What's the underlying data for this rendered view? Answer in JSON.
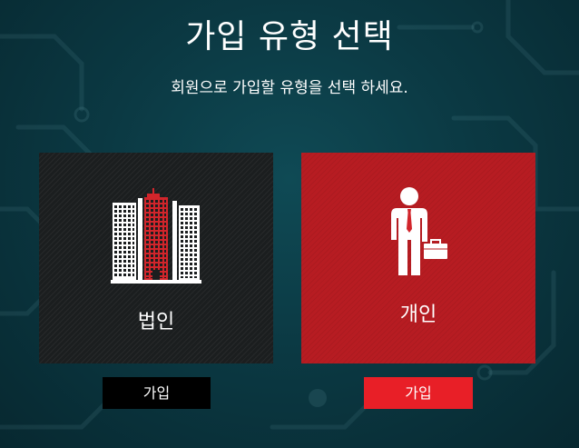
{
  "header": {
    "title": "가입 유형 선택",
    "subtitle": "회원으로 가입할 유형을 선택 하세요."
  },
  "cards": {
    "corporate": {
      "label": "법인",
      "icon": "buildings-icon",
      "join_label": "가입"
    },
    "personal": {
      "label": "개인",
      "icon": "businessman-icon",
      "join_label": "가입"
    }
  },
  "colors": {
    "background": "#0b3943",
    "corporate_card": "#1b1e1f",
    "personal_card": "#b71c22",
    "corporate_button": "#000000",
    "personal_button": "#e81f27",
    "accent": "#d2252b"
  }
}
